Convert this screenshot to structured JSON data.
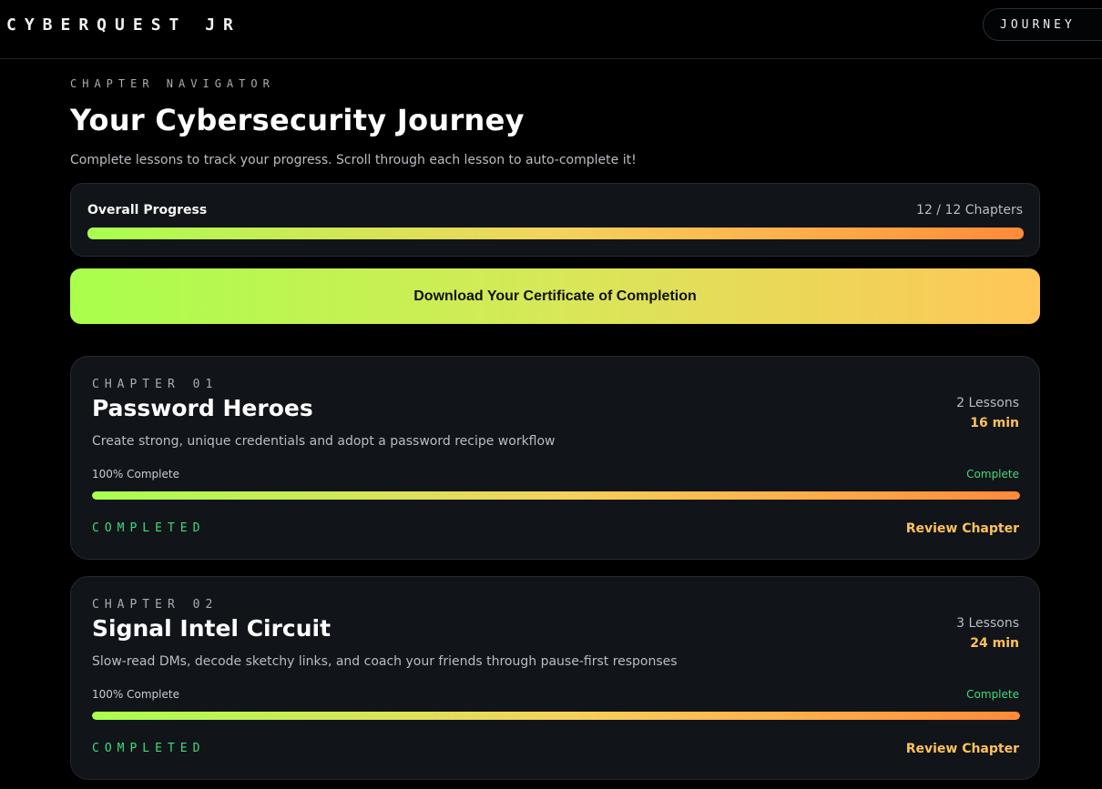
{
  "header": {
    "brand": "CYBERQUEST JR",
    "nav_button": "JOURNEY"
  },
  "intro": {
    "eyebrow": "CHAPTER NAVIGATOR",
    "title": "Your Cybersecurity Journey",
    "subtitle": "Complete lessons to track your progress. Scroll through each lesson to auto-complete it!"
  },
  "overall": {
    "label": "Overall Progress",
    "count": "12 / 12 Chapters",
    "progress": 1.0
  },
  "certificate": {
    "label": "Download Your Certificate of Completion"
  },
  "chapters": [
    {
      "eyebrow": "CHAPTER 01",
      "title": "Password Heroes",
      "lessons": "2 Lessons",
      "time": "16 min",
      "description": "Create strong, unique credentials and adopt a password recipe workflow",
      "percent_label": "100% Complete",
      "status": "Complete",
      "progress": 1.0,
      "state": "COMPLETED",
      "action": "Review Chapter"
    },
    {
      "eyebrow": "CHAPTER 02",
      "title": "Signal Intel Circuit",
      "lessons": "3 Lessons",
      "time": "24 min",
      "description": "Slow-read DMs, decode sketchy links, and coach your friends through pause-first responses",
      "percent_label": "100% Complete",
      "status": "Complete",
      "progress": 1.0,
      "state": "COMPLETED",
      "action": "Review Chapter"
    }
  ],
  "colors": {
    "accent_green": "#3fdc7a",
    "accent_orange": "#ffc25a",
    "gradient_start": "#a8ff4f",
    "gradient_end": "#ff8a3a"
  }
}
